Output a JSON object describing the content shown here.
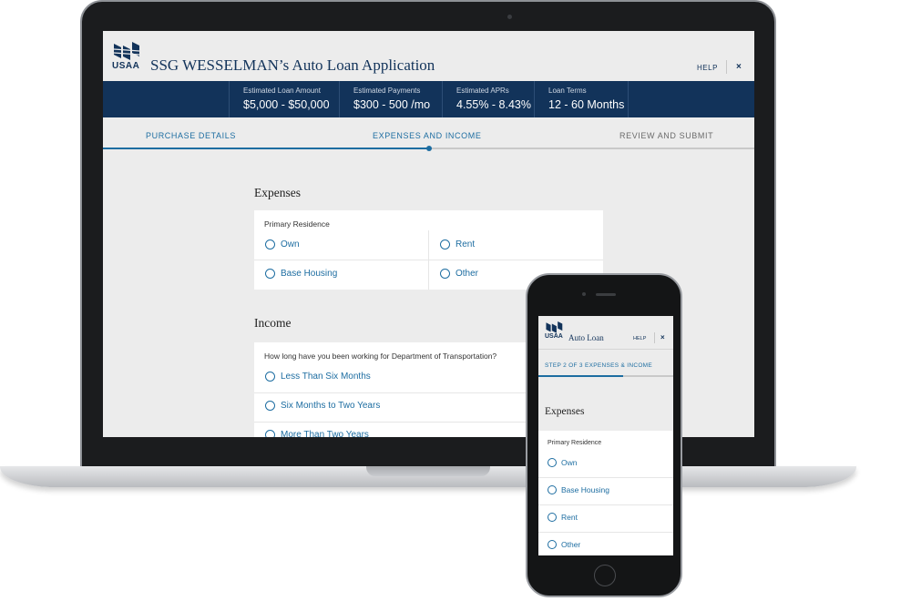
{
  "app": {
    "logo_text": "USAA",
    "title": "SSG WESSELMAN’s Auto Loan Application",
    "help": "HELP",
    "close": "×"
  },
  "summary": [
    {
      "label": "Estimated Loan Amount",
      "value": "$5,000 - $50,000"
    },
    {
      "label": "Estimated Payments",
      "value": "$300 - 500 /mo"
    },
    {
      "label": "Estimated APRs",
      "value": "4.55% - 8.43%"
    },
    {
      "label": "Loan Terms",
      "value": "12 - 60 Months"
    }
  ],
  "steps": {
    "step1": "PURCHASE DETAILS",
    "step2": "EXPENSES AND INCOME",
    "step3": "REVIEW AND SUBMIT",
    "current": 2,
    "progress_fraction": 0.5
  },
  "expenses": {
    "title": "Expenses",
    "question": "Primary Residence",
    "options": [
      "Own",
      "Rent",
      "Base Housing",
      "Other"
    ]
  },
  "income": {
    "title": "Income",
    "question": "How long have you been working for Department of Transportation?",
    "options": [
      "Less Than Six Months",
      "Six Months to Two Years",
      "More Than Two Years"
    ]
  },
  "mobile": {
    "logo_text": "USAA",
    "title": "Auto Loan",
    "help": "HELP",
    "close": "×",
    "step_label": "STEP 2 OF 3   EXPENSES & INCOME",
    "section_title": "Expenses",
    "question": "Primary Residence",
    "options": [
      "Own",
      "Base Housing",
      "Rent",
      "Other"
    ]
  },
  "colors": {
    "brand_navy": "#12335a",
    "accent_blue": "#1d6da1",
    "page_bg": "#ececec"
  }
}
